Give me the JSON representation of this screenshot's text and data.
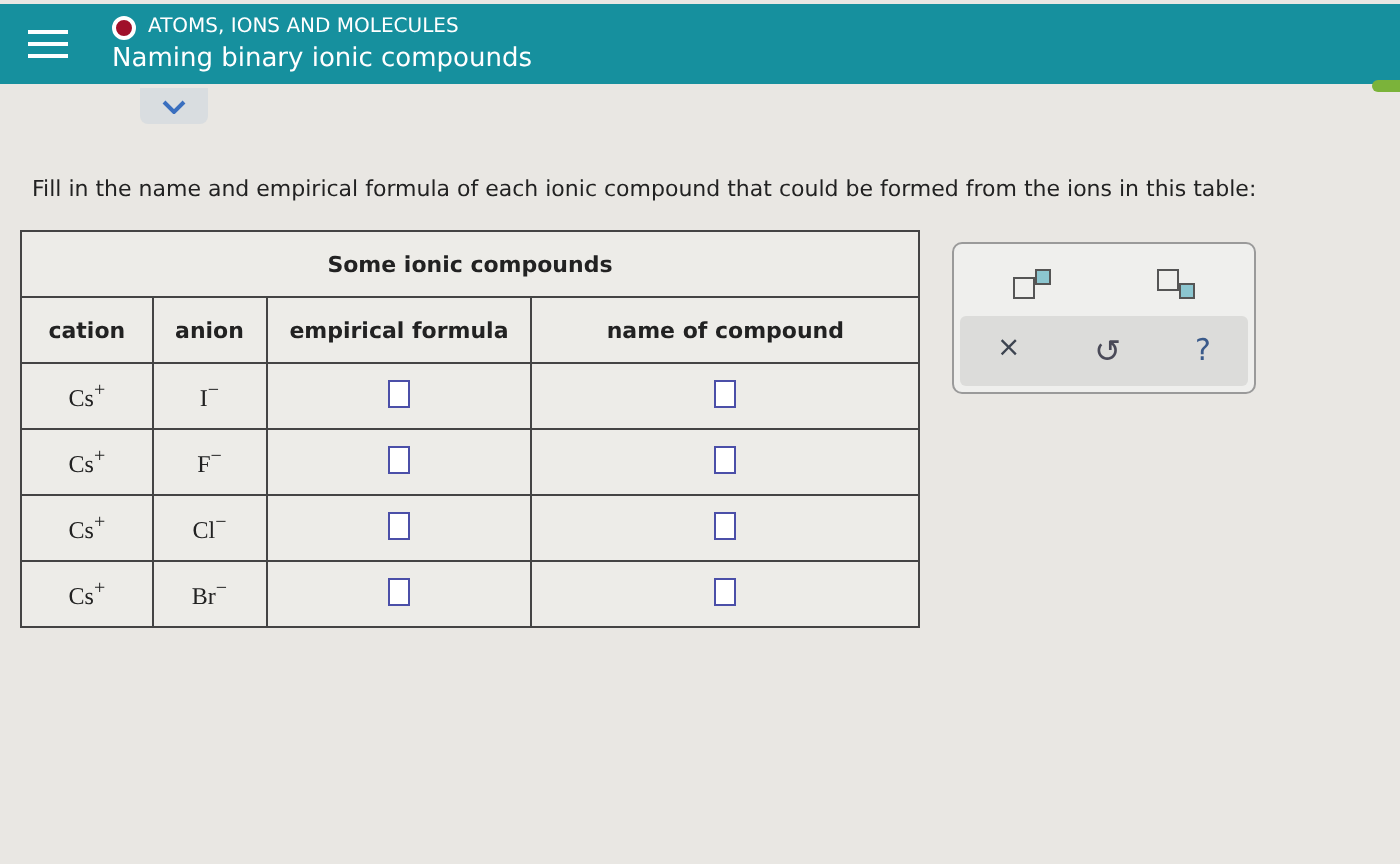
{
  "header": {
    "topic": "ATOMS, IONS AND MOLECULES",
    "title": "Naming binary ionic compounds"
  },
  "instructions": "Fill in the name and empirical formula of each ionic compound that could be formed from the ions in this table:",
  "table": {
    "title": "Some ionic compounds",
    "columns": [
      "cation",
      "anion",
      "empirical formula",
      "name of compound"
    ],
    "rows": [
      {
        "cation": "Cs$^{+}$",
        "anion": "I$^{−}$"
      },
      {
        "cation": "Cs$^{+}$",
        "anion": "F$^{−}$"
      },
      {
        "cation": "Cs$^{+}$",
        "anion": "Cl$^{−}$"
      },
      {
        "cation": "Cs$^{+}$",
        "anion": "Br$^{−}$"
      }
    ]
  },
  "tool_panel": {
    "templates": [
      {
        "kind": "superscript"
      },
      {
        "kind": "subscript"
      }
    ],
    "actions": [
      {
        "kind": "clear",
        "label": "×"
      },
      {
        "kind": "undo",
        "label": "↺"
      },
      {
        "kind": "help",
        "label": "?"
      }
    ]
  }
}
